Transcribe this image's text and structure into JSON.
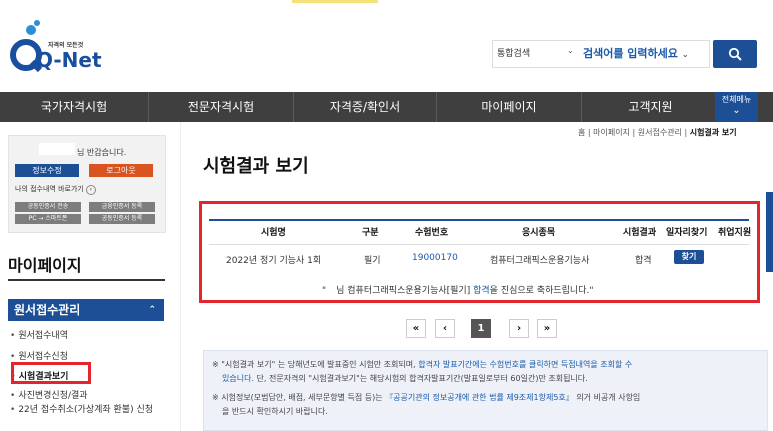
{
  "header": {
    "logo_small": "자격의 모든것",
    "logo_main": "Q-Net",
    "search_scope": "통합검색",
    "search_placeholder": "검색어를 입력하세요"
  },
  "nav": {
    "items": [
      "국가자격시험",
      "전문자격시험",
      "자격증/확인서",
      "마이페이지",
      "고객지원"
    ],
    "all_menu": "전체메뉴"
  },
  "sidebar": {
    "greeting": "님 반갑습니다.",
    "info_button": "정보수정",
    "logout_button": "로그아웃",
    "recent_link": "나의 접수내역 바로가기",
    "cert_buttons": [
      "공동인증서 전송",
      "금융인증서 등록",
      "PC → 스마트폰",
      "공동인증서 등록"
    ],
    "section_title": "마이페이지",
    "group_title": "원서접수관리",
    "links": [
      "원서접수내역",
      "원서접수신청",
      "시험결과보기",
      "사진변경신청/결과",
      "22년 접수취소(가상계좌 환불) 신청"
    ]
  },
  "breadcrumb": {
    "home": "홈",
    "path1": "마이페이지",
    "path2": "원서접수관리",
    "current": "시험결과 보기"
  },
  "main": {
    "title": "시험결과 보기",
    "table": {
      "headers": [
        "시험명",
        "구분",
        "수험번호",
        "응시종목",
        "시험결과",
        "일자리찾기",
        "취업지원"
      ],
      "row": {
        "exam": "2022년 정기 기능사 1회",
        "type": "필기",
        "number": "19000170",
        "subject": "컴퓨터그래픽스운용기능사",
        "result": "합격",
        "find_button": "찾기"
      },
      "congrats_prefix": "\"",
      "congrats_mid": "님 컴퓨터그래픽스운용기능사[필기]",
      "congrats_pass": "합격",
      "congrats_end": "을 진심으로 축하드립니다.\""
    },
    "pager": {
      "first": "«",
      "prev": "‹",
      "page": "1",
      "next": "›",
      "last": "»"
    },
    "notice": {
      "line1a": "※ \"시험결과 보기\" 는 당해년도에 발표중인 시험만 조회되며, ",
      "line1b": "합격자 발표기간에는 수험번호를 클릭하면 득점내역을 조회할 수",
      "line2a": "있습니다.",
      "line2b": " 단, 전문자격의 \"시험결과보기\"는 해당시험의 합격자발표기간(발표일로부터 60일간)만 조회됩니다.",
      "line3a": "※ 시험정보(모범답안, 배점, 세부문항별 득점 등)는 ",
      "line3b": "『공공기관의 정보공개에 관한 법률 제9조제1항제5호』",
      "line3c": " 의거 비공개 사항임",
      "line4": "을 반드시 확인하시기 바랍니다."
    }
  },
  "colors": {
    "primary": "#1c4f96",
    "accent": "#d9541e",
    "highlight": "#e3262e",
    "nav_bg": "#3f3f3f"
  }
}
